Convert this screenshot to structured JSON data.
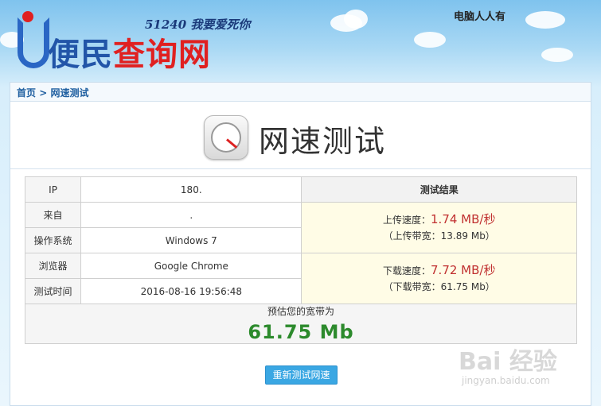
{
  "header": {
    "logo_top": "51240 我要爱死你",
    "logo_main_blue": "便民",
    "logo_main_red": "查询网",
    "slogan": "电脑人人有"
  },
  "breadcrumb": {
    "home": "首页",
    "separator": ">",
    "current": "网速测试"
  },
  "page_title": "网速测试",
  "info_table": {
    "rows": [
      {
        "label": "IP",
        "value": "180."
      },
      {
        "label": "来自",
        "value": "."
      },
      {
        "label": "操作系统",
        "value": "Windows 7"
      },
      {
        "label": "浏览器",
        "value": "Google Chrome"
      },
      {
        "label": "测试时间",
        "value": "2016-08-16 19:56:48"
      }
    ]
  },
  "result": {
    "header": "测试结果",
    "upload_label": "上传速度：",
    "upload_speed": "1.74 MB/秒",
    "upload_bandwidth": "（上传带宽：13.89 Mb）",
    "download_label": "下载速度：",
    "download_speed": "7.72 MB/秒",
    "download_bandwidth": "（下载带宽：61.75 Mb）"
  },
  "bandwidth": {
    "label": "预估您的宽带为",
    "value": "61.75 Mb"
  },
  "retest_button": "重新测试网速",
  "watermark": {
    "main": "Bai 经验",
    "sub": "jingyan.baidu.com"
  },
  "colors": {
    "accent_blue": "#3aa7e3",
    "speed_red": "#c03030",
    "bandwidth_green": "#2c8a2c"
  }
}
